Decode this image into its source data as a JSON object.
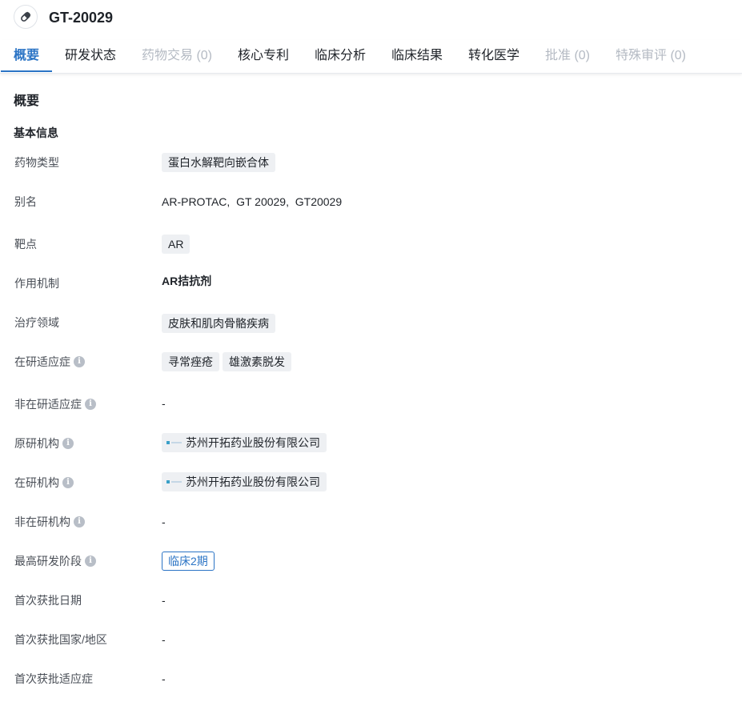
{
  "header": {
    "title": "GT-20029",
    "icon": "pill-icon"
  },
  "tabs": [
    {
      "label": "概要",
      "state": "active"
    },
    {
      "label": "研发状态",
      "state": "normal"
    },
    {
      "label": "药物交易 (0)",
      "state": "disabled"
    },
    {
      "label": "核心专利",
      "state": "normal"
    },
    {
      "label": "临床分析",
      "state": "normal"
    },
    {
      "label": "临床结果",
      "state": "normal"
    },
    {
      "label": "转化医学",
      "state": "normal"
    },
    {
      "label": "批准 (0)",
      "state": "disabled"
    },
    {
      "label": "特殊审评 (0)",
      "state": "disabled"
    }
  ],
  "section": {
    "title": "概要",
    "subtitle": "基本信息"
  },
  "fields": {
    "drug_type": {
      "label": "药物类型",
      "tags": [
        "蛋白水解靶向嵌合体"
      ]
    },
    "alias": {
      "label": "别名",
      "value": "AR-PROTAC,  GT 20029,  GT20029"
    },
    "target": {
      "label": "靶点",
      "tags": [
        "AR"
      ]
    },
    "mechanism": {
      "label": "作用机制",
      "value": "AR拮抗剂"
    },
    "therapeutic_area": {
      "label": "治疗领域",
      "tags": [
        "皮肤和肌肉骨骼疾病"
      ]
    },
    "active_indication": {
      "label": "在研适应症",
      "tags": [
        "寻常痤疮",
        "雄激素脱发"
      ]
    },
    "inactive_indication": {
      "label": "非在研适应症",
      "value": "-"
    },
    "originator": {
      "label": "原研机构",
      "org": "苏州开拓药业股份有限公司"
    },
    "active_org": {
      "label": "在研机构",
      "org": "苏州开拓药业股份有限公司"
    },
    "inactive_org": {
      "label": "非在研机构",
      "value": "-"
    },
    "highest_phase": {
      "label": "最高研发阶段",
      "phase": "临床2期"
    },
    "first_approval_date": {
      "label": "首次获批日期",
      "value": "-"
    },
    "first_approval_region": {
      "label": "首次获批国家/地区",
      "value": "-"
    },
    "first_approval_indication": {
      "label": "首次获批适应症",
      "value": "-"
    }
  },
  "colors": {
    "accent": "#2b74c5",
    "disabled": "#b4bac3",
    "tag_bg": "#eef0f3",
    "info_icon": "#b8bec7"
  }
}
